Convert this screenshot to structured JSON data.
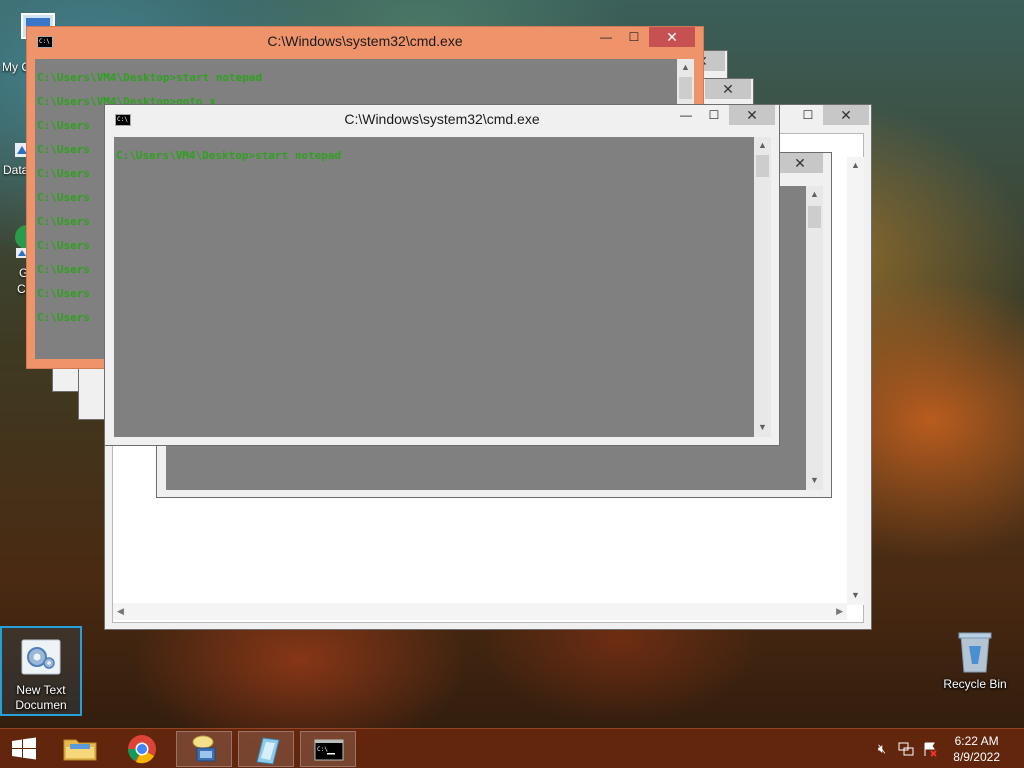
{
  "desktop": {
    "icons": [
      {
        "label_line1": "New Text",
        "label_line2": "Documen",
        "icon": "notepad-icon"
      },
      {
        "label_line1": "Recycle Bin",
        "label_line2": "",
        "icon": "recycle-bin-icon"
      }
    ],
    "partial_icons": [
      {
        "label": "My C"
      },
      {
        "label": "Data"
      },
      {
        "label": "G"
      },
      {
        "label": "C"
      }
    ]
  },
  "windows": {
    "cmd_front": {
      "title": "C:\\Windows\\system32\\cmd.exe",
      "lines": [
        "C:\\Users\\VM4\\Desktop>start notepad"
      ]
    },
    "cmd_back": {
      "title": "C:\\Windows\\system32\\cmd.exe",
      "lines": [
        "C:\\Users\\VM4\\Desktop>start notepad",
        "C:\\Users\\VM4\\Desktop>goto x",
        "C:\\Users",
        "C:\\Users",
        "C:\\Users",
        "C:\\Users",
        "C:\\Users",
        "C:\\Users",
        "C:\\Users",
        "C:\\Users",
        "C:\\Users"
      ]
    },
    "controls": {
      "minimize": "—",
      "maximize": "☐",
      "close": "✕"
    }
  },
  "taskbar": {
    "items": [
      {
        "name": "start-button",
        "icon": "windows-logo-icon"
      },
      {
        "name": "file-explorer",
        "icon": "folder-icon"
      },
      {
        "name": "chrome",
        "icon": "chrome-icon"
      },
      {
        "name": "remote-desktop",
        "icon": "network-user-icon"
      },
      {
        "name": "notepad",
        "icon": "notepad-icon"
      },
      {
        "name": "command-prompt",
        "icon": "cmd-icon"
      }
    ],
    "tray": {
      "icons": [
        "volume-muted-icon",
        "network-icon",
        "action-center-icon"
      ],
      "time": "6:22 AM",
      "date": "8/9/2022"
    }
  },
  "colors": {
    "console_text": "#2ea11e",
    "console_bg": "#808080",
    "active_titlebar": "#ef936b",
    "selection_border": "#26a0da"
  }
}
